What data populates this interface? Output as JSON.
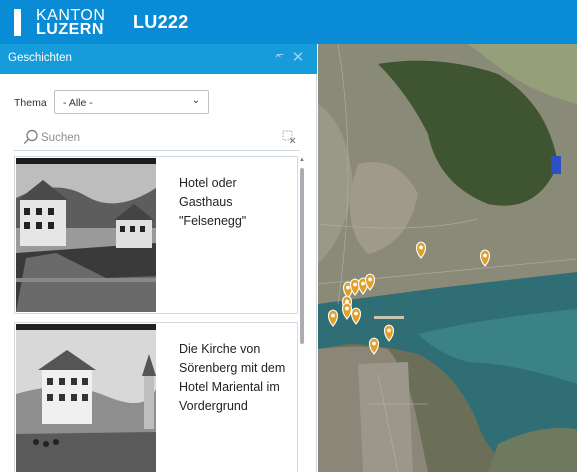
{
  "header": {
    "logo_line1": "KANTON",
    "logo_line2": "LUZERN",
    "app_title": "LU222"
  },
  "panel": {
    "title": "Geschichten",
    "collapse_icon": "double-chevron-up-icon",
    "close_icon": "close-icon"
  },
  "filter": {
    "label": "Thema",
    "selected": "- Alle -"
  },
  "search": {
    "placeholder": "Suchen",
    "value": ""
  },
  "stories": [
    {
      "title": "Hotel oder Gasthaus \"Felsenegg\""
    },
    {
      "title": "Die Kirche von Sörenberg mit dem Hotel Mariental im Vordergrund"
    }
  ],
  "map": {
    "marker_color": "#e0a02a",
    "marker_count": 12
  }
}
